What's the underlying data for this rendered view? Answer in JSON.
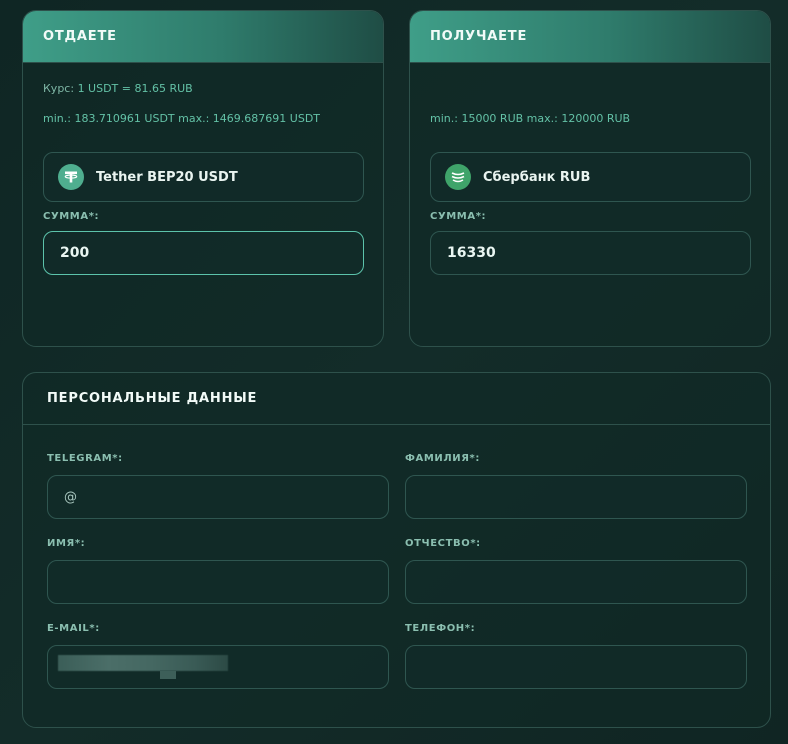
{
  "give": {
    "title": "ОТДАЕТЕ",
    "rate_label": "Курс:",
    "rate_value": "1 USDT = 81.65 RUB",
    "limits": "min.: 183.710961 USDT max.: 1469.687691 USDT",
    "currency": "Tether BEP20 USDT",
    "currency_icon": "tether-icon",
    "amount_label": "СУММА*:",
    "amount": "200"
  },
  "get": {
    "title": "ПОЛУЧАЕТЕ",
    "limits": "min.: 15000 RUB max.: 120000 RUB",
    "currency": "Сбербанк RUB",
    "currency_icon": "sberbank-icon",
    "amount_label": "СУММА*:",
    "amount": "16330"
  },
  "personal": {
    "title": "ПЕРСОНАЛЬНЫЕ ДАННЫЕ",
    "telegram_label": "TELEGRAM*:",
    "telegram_placeholder": "@",
    "surname_label": "ФАМИЛИЯ*:",
    "name_label": "ИМЯ*:",
    "patronymic_label": "ОТЧЕСТВО*:",
    "email_label": "E-MAIL*:",
    "phone_label": "ТЕЛЕФОН*:"
  },
  "colors": {
    "accent": "#3f9e88",
    "tether": "#4fae8f",
    "sberbank": "#3fa46a"
  }
}
